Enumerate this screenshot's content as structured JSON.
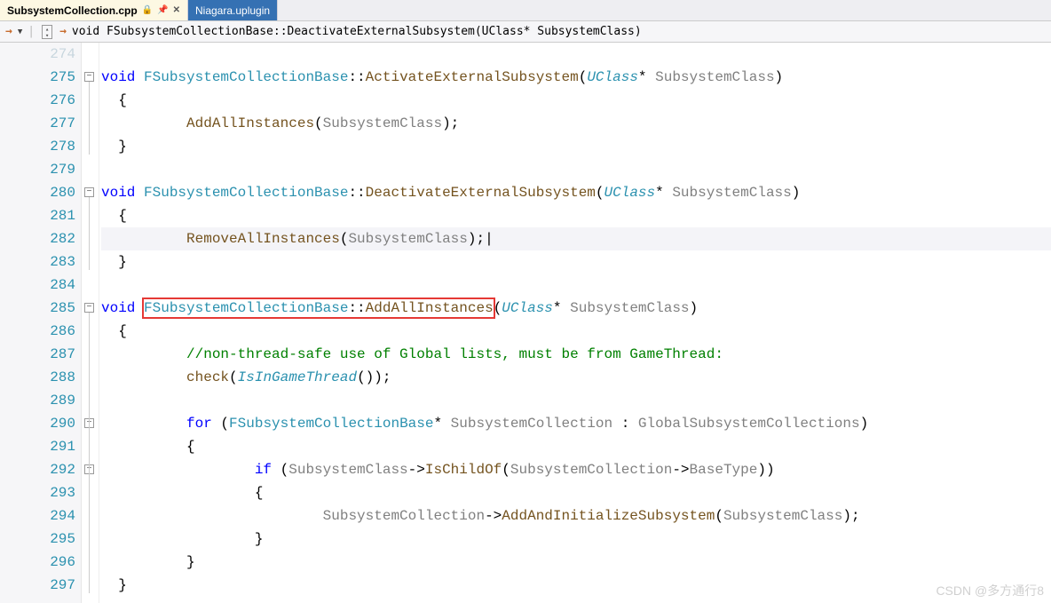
{
  "tabs": [
    {
      "label": "SubsystemCollection.cpp",
      "active": true,
      "locked": true
    },
    {
      "label": "Niagara.uplugin",
      "active": false,
      "locked": false
    }
  ],
  "breadcrumb": "void FSubsystemCollectionBase::DeactivateExternalSubsystem(UClass* SubsystemClass)",
  "line_start": 274,
  "line_end": 297,
  "active_line": 282,
  "code_lines": [
    {
      "n": 274,
      "tokens": []
    },
    {
      "n": 275,
      "tokens": [
        [
          "kw",
          "void"
        ],
        [
          "",
          ""
        ],
        [
          "type",
          " FSubsystemCollectionBase"
        ],
        [
          "op",
          "::"
        ],
        [
          "func",
          "ActivateExternalSubsystem"
        ],
        [
          "op",
          "("
        ],
        [
          "type",
          "UClass"
        ],
        [
          "op",
          "* "
        ],
        [
          "param",
          "SubsystemClass"
        ],
        [
          "op",
          ")"
        ]
      ]
    },
    {
      "n": 276,
      "tokens": [
        [
          "brace",
          "{"
        ]
      ]
    },
    {
      "n": 277,
      "tokens": [
        [
          "",
          "    "
        ],
        [
          "func",
          "AddAllInstances"
        ],
        [
          "op",
          "("
        ],
        [
          "param",
          "SubsystemClass"
        ],
        [
          "op",
          ");"
        ]
      ]
    },
    {
      "n": 278,
      "tokens": [
        [
          "brace",
          "}"
        ]
      ]
    },
    {
      "n": 279,
      "tokens": []
    },
    {
      "n": 280,
      "tokens": [
        [
          "kw",
          "void"
        ],
        [
          "type",
          " FSubsystemCollectionBase"
        ],
        [
          "op",
          "::"
        ],
        [
          "func",
          "DeactivateExternalSubsystem"
        ],
        [
          "op",
          "("
        ],
        [
          "type",
          "UClass"
        ],
        [
          "op",
          "* "
        ],
        [
          "param",
          "SubsystemClass"
        ],
        [
          "op",
          ")"
        ]
      ]
    },
    {
      "n": 281,
      "tokens": [
        [
          "brace",
          "{"
        ]
      ]
    },
    {
      "n": 282,
      "tokens": [
        [
          "",
          "    "
        ],
        [
          "func",
          "RemoveAllInstances"
        ],
        [
          "op",
          "("
        ],
        [
          "param",
          "SubsystemClass"
        ],
        [
          "op",
          ");"
        ],
        [
          "",
          "|"
        ]
      ]
    },
    {
      "n": 283,
      "tokens": [
        [
          "brace",
          "}"
        ]
      ]
    },
    {
      "n": 284,
      "tokens": []
    },
    {
      "n": 285,
      "tokens": [
        [
          "kw",
          "void"
        ],
        [
          "type",
          " FSubsystemCollectionBase"
        ],
        [
          "op",
          "::"
        ],
        [
          "func",
          "AddAllInstances"
        ],
        [
          "op",
          "("
        ],
        [
          "type",
          "UClass"
        ],
        [
          "op",
          "* "
        ],
        [
          "param",
          "SubsystemClass"
        ],
        [
          "op",
          ")"
        ]
      ]
    },
    {
      "n": 286,
      "tokens": [
        [
          "brace",
          "{"
        ]
      ]
    },
    {
      "n": 287,
      "tokens": [
        [
          "",
          "    "
        ],
        [
          "cmt",
          "//non-thread-safe use of Global lists, must be from GameThread:"
        ]
      ]
    },
    {
      "n": 288,
      "tokens": [
        [
          "",
          "    "
        ],
        [
          "func",
          "check"
        ],
        [
          "op",
          "("
        ],
        [
          "type",
          "IsInGameThread"
        ],
        [
          "op",
          "());"
        ]
      ]
    },
    {
      "n": 289,
      "tokens": []
    },
    {
      "n": 290,
      "tokens": [
        [
          "",
          "    "
        ],
        [
          "kw",
          "for"
        ],
        [
          "op",
          " ("
        ],
        [
          "type",
          "FSubsystemCollectionBase"
        ],
        [
          "op",
          "* "
        ],
        [
          "param",
          "SubsystemCollection"
        ],
        [
          "op",
          " : "
        ],
        [
          "param",
          "GlobalSubsystemCollections"
        ],
        [
          "op",
          ")"
        ]
      ]
    },
    {
      "n": 291,
      "tokens": [
        [
          "",
          "    "
        ],
        [
          "brace",
          "{"
        ]
      ]
    },
    {
      "n": 292,
      "tokens": [
        [
          "",
          "        "
        ],
        [
          "kw",
          "if"
        ],
        [
          "op",
          " ("
        ],
        [
          "param",
          "SubsystemClass"
        ],
        [
          "op",
          "->"
        ],
        [
          "func",
          "IsChildOf"
        ],
        [
          "op",
          "("
        ],
        [
          "param",
          "SubsystemCollection"
        ],
        [
          "op",
          "->"
        ],
        [
          "param",
          "BaseType"
        ],
        [
          "op",
          "))"
        ]
      ]
    },
    {
      "n": 293,
      "tokens": [
        [
          "",
          "        "
        ],
        [
          "brace",
          "{"
        ]
      ]
    },
    {
      "n": 294,
      "tokens": [
        [
          "",
          "            "
        ],
        [
          "param",
          "SubsystemCollection"
        ],
        [
          "op",
          "->"
        ],
        [
          "func",
          "AddAndInitializeSubsystem"
        ],
        [
          "op",
          "("
        ],
        [
          "param",
          "SubsystemClass"
        ],
        [
          "op",
          ");"
        ]
      ]
    },
    {
      "n": 295,
      "tokens": [
        [
          "",
          "        "
        ],
        [
          "brace",
          "}"
        ]
      ]
    },
    {
      "n": 296,
      "tokens": [
        [
          "",
          "    "
        ],
        [
          "brace",
          "}"
        ]
      ]
    },
    {
      "n": 297,
      "tokens": [
        [
          "brace",
          "}"
        ]
      ]
    }
  ],
  "fold_markers": [
    {
      "line": 275,
      "kind": "minus"
    },
    {
      "line": 280,
      "kind": "minus"
    },
    {
      "line": 285,
      "kind": "minus"
    },
    {
      "line": 290,
      "kind": "minus"
    },
    {
      "line": 292,
      "kind": "minus"
    }
  ],
  "highlight": {
    "text_start": "FSubsystemCollectionBase::AddAllInstances",
    "line": 285
  },
  "watermark": "CSDN @多方通行8"
}
